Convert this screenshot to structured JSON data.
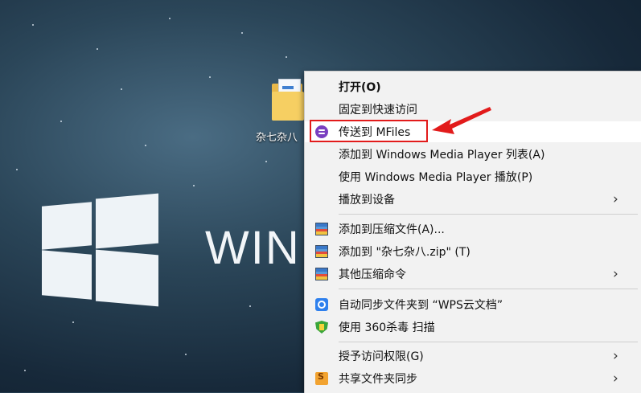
{
  "desktop": {
    "folder_label": "杂七杂八",
    "windows_text": "WINDOWS"
  },
  "context_menu": {
    "items": [
      {
        "label": "打开(O)",
        "bold": true,
        "icon": null,
        "submenu": false
      },
      {
        "label": "固定到快速访问",
        "icon": null,
        "submenu": false
      },
      {
        "label": "传送到 MFiles",
        "icon": "mfiles-icon",
        "submenu": false,
        "highlighted": true
      },
      {
        "label": "添加到 Windows Media Player 列表(A)",
        "icon": null,
        "submenu": false
      },
      {
        "label": "使用 Windows Media Player 播放(P)",
        "icon": null,
        "submenu": false
      },
      {
        "label": "播放到设备",
        "icon": null,
        "submenu": true
      },
      {
        "label": "添加到压缩文件(A)...",
        "icon": "winrar-icon",
        "submenu": false
      },
      {
        "label": "添加到 \"杂七杂八.zip\" (T)",
        "icon": "winrar-icon",
        "submenu": false
      },
      {
        "label": "其他压缩命令",
        "icon": "winrar-icon",
        "submenu": true
      },
      {
        "label": "自动同步文件夹到 “WPS云文档”",
        "icon": "wps-sync-icon",
        "submenu": false
      },
      {
        "label": "使用 360杀毒 扫描",
        "icon": "360-shield-icon",
        "submenu": false
      },
      {
        "label": "授予访问权限(G)",
        "icon": null,
        "submenu": true
      },
      {
        "label": "共享文件夹同步",
        "icon": "share-sync-icon",
        "submenu": true
      }
    ],
    "submenu_arrow": "›"
  },
  "annotation": {
    "highlight_color": "#e21b1b"
  }
}
